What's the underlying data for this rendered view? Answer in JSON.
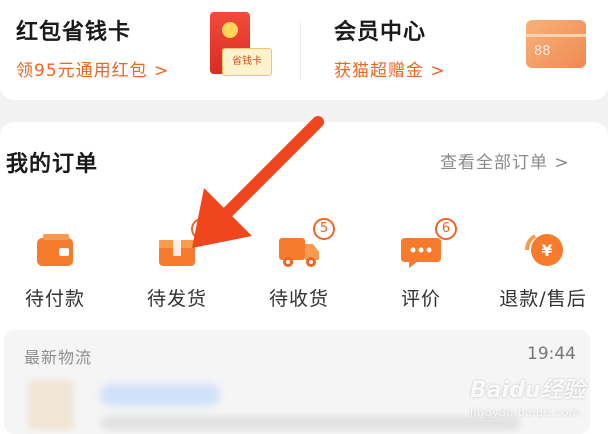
{
  "promos": [
    {
      "title": "红包省钱卡",
      "subtitle": "领95元通用红包 >",
      "badge_text": "省钱卡"
    },
    {
      "title": "会员中心",
      "subtitle": "获猫超赠金 >",
      "card_text": "88"
    }
  ],
  "orders": {
    "title": "我的订单",
    "view_all": "查看全部订单 >",
    "items": [
      {
        "label": "待付款",
        "icon": "wallet-icon",
        "badge": null
      },
      {
        "label": "待发货",
        "icon": "package-icon",
        "badge": "1"
      },
      {
        "label": "待收货",
        "icon": "truck-icon",
        "badge": "5"
      },
      {
        "label": "评价",
        "icon": "comment-icon",
        "badge": "6"
      },
      {
        "label": "退款/售后",
        "icon": "refund-icon",
        "badge": null
      }
    ]
  },
  "logistics": {
    "title": "最新物流",
    "time": "19:44"
  },
  "watermark": {
    "main": "Baidu经验",
    "sub": "jingyan.baidu.com"
  },
  "colors": {
    "accent": "#f06425",
    "arrow": "#f0461e",
    "text": "#1a1a1a",
    "muted": "#8a8a8a"
  }
}
